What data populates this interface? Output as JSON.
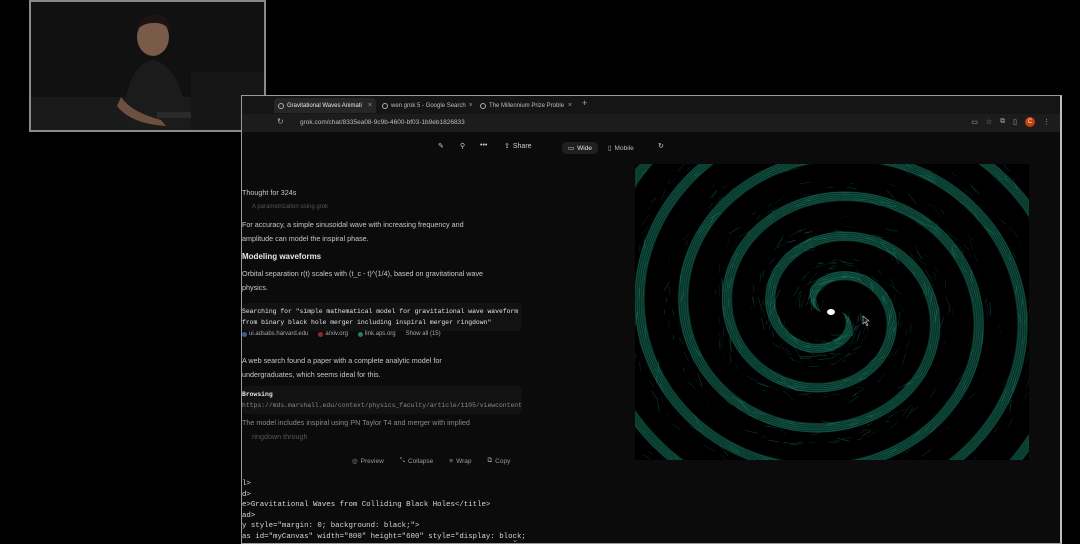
{
  "browser": {
    "tabs": [
      {
        "title": "Gravitational Waves Animati",
        "active": true
      },
      {
        "title": "wen grok 5 - Google Search",
        "active": false
      },
      {
        "title": "The Millennium Prize Proble",
        "active": false
      }
    ],
    "url": "grok.com/chat/8335ea08-9c9b-4600-bf03-1b9eb1826833",
    "profile_initial": "C"
  },
  "toolbar": {
    "share_label": "Share",
    "wide_label": "Wide",
    "mobile_label": "Mobile"
  },
  "chat": {
    "thought_label": "Thought for 324s",
    "faded_line": "A parametrization using grok",
    "para1_line1": "For accuracy, a simple sinusoidal wave with increasing frequency and",
    "para1_line2": "amplitude can model the inspiral phase.",
    "heading": "Modeling waveforms",
    "para2_line1": "Orbital separation r(t) scales with (t_c - t)^(1/4), based on gravitational wave",
    "para2_line2": "physics.",
    "search_line1": "Searching for \"simple mathematical model for gravitational wave waveform",
    "search_line2": "from binary black hole merger including inspiral merger ringdown\"",
    "sources": [
      "ui.adsabs.harvard.edu",
      "arxiv.org",
      "link.aps.org"
    ],
    "show_all": "Show all (15)",
    "para3_line1": "A web search found a paper with a complete analytic model for",
    "para3_line2": "undergraduates, which seems ideal for this.",
    "browsing_label": "Browsing",
    "browsing_url": "https://mds.marshall.edu/context/physics_faculty/article/1105/viewcontent",
    "para4_line1": "The model includes inspiral using PN Taylor T4 and merger with implied",
    "para4_line2": "ringdown through"
  },
  "code_actions": [
    "Preview",
    "Collapse",
    "Wrap",
    "Copy"
  ],
  "code_lines": [
    "l>",
    "d>",
    "e>Gravitational Waves from Colliding Black Holes</title>",
    "ad>",
    "y style=\"margin: 0; background: black;\">",
    "as id=\"myCanvas\" width=\"800\" height=\"600\" style=\"display: block;"
  ],
  "colors": {
    "wave": "#2dd4aa",
    "background": "#000000",
    "accent": "#c2410c"
  }
}
